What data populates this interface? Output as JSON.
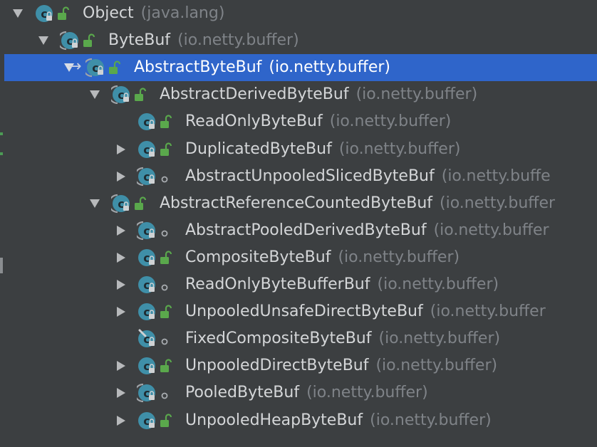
{
  "tree": {
    "rows": [
      {
        "name": "Object",
        "pkg": "(java.lang)",
        "level": 0,
        "arrow": "expanded",
        "access": "public",
        "abstract": false,
        "selected": false
      },
      {
        "name": "ByteBuf",
        "pkg": "(io.netty.buffer)",
        "level": 1,
        "arrow": "expanded",
        "access": "public",
        "abstract": true,
        "selected": false
      },
      {
        "name": "AbstractByteBuf",
        "pkg": "(io.netty.buffer)",
        "level": 2,
        "arrow": "expanded",
        "access": "public",
        "abstract": true,
        "selected": true,
        "jump": true
      },
      {
        "name": "AbstractDerivedByteBuf",
        "pkg": "(io.netty.buffer)",
        "level": 3,
        "arrow": "expanded",
        "access": "public",
        "abstract": true,
        "selected": false
      },
      {
        "name": "ReadOnlyByteBuf",
        "pkg": "(io.netty.buffer)",
        "level": 4,
        "arrow": "none",
        "access": "public",
        "abstract": false,
        "selected": false
      },
      {
        "name": "DuplicatedByteBuf",
        "pkg": "(io.netty.buffer)",
        "level": 4,
        "arrow": "collapsed",
        "access": "public",
        "abstract": false,
        "selected": false
      },
      {
        "name": "AbstractUnpooledSlicedByteBuf",
        "pkg": "(io.netty.buffe",
        "level": 4,
        "arrow": "collapsed",
        "access": "package",
        "abstract": true,
        "selected": false
      },
      {
        "name": "AbstractReferenceCountedByteBuf",
        "pkg": "(io.netty.buffer",
        "level": 3,
        "arrow": "expanded",
        "access": "public",
        "abstract": true,
        "selected": false
      },
      {
        "name": "AbstractPooledDerivedByteBuf",
        "pkg": "(io.netty.buffer",
        "level": 4,
        "arrow": "collapsed",
        "access": "package",
        "abstract": true,
        "selected": false
      },
      {
        "name": "CompositeByteBuf",
        "pkg": "(io.netty.buffer)",
        "level": 4,
        "arrow": "collapsed",
        "access": "public",
        "abstract": false,
        "selected": false
      },
      {
        "name": "ReadOnlyByteBufferBuf",
        "pkg": "(io.netty.buffer)",
        "level": 4,
        "arrow": "collapsed",
        "access": "package",
        "abstract": false,
        "selected": false
      },
      {
        "name": "UnpooledUnsafeDirectByteBuf",
        "pkg": "(io.netty.buffer",
        "level": 4,
        "arrow": "collapsed",
        "access": "public",
        "abstract": false,
        "selected": false
      },
      {
        "name": "FixedCompositeByteBuf",
        "pkg": "(io.netty.buffer)",
        "level": 4,
        "arrow": "none",
        "access": "package",
        "abstract": false,
        "final": true,
        "selected": false
      },
      {
        "name": "UnpooledDirectByteBuf",
        "pkg": "(io.netty.buffer)",
        "level": 4,
        "arrow": "collapsed",
        "access": "public",
        "abstract": false,
        "selected": false
      },
      {
        "name": "PooledByteBuf",
        "pkg": "(io.netty.buffer)",
        "level": 4,
        "arrow": "collapsed",
        "access": "package",
        "abstract": true,
        "selected": false
      },
      {
        "name": "UnpooledHeapByteBuf",
        "pkg": "(io.netty.buffer)",
        "level": 4,
        "arrow": "collapsed",
        "access": "public",
        "abstract": false,
        "selected": false
      }
    ]
  },
  "colors": {
    "background": "#3c3f41",
    "selection": "#2f65ca",
    "class_icon": "#3f8fa8",
    "lock_green": "#5aa84c",
    "package_text": "#7f8388"
  },
  "icons": {
    "class": "class-c-icon",
    "abstract_class": "abstract-class-icon",
    "public": "unlocked-padlock-icon",
    "package_private": "package-private-dot-icon",
    "final": "final-pin-icon"
  }
}
